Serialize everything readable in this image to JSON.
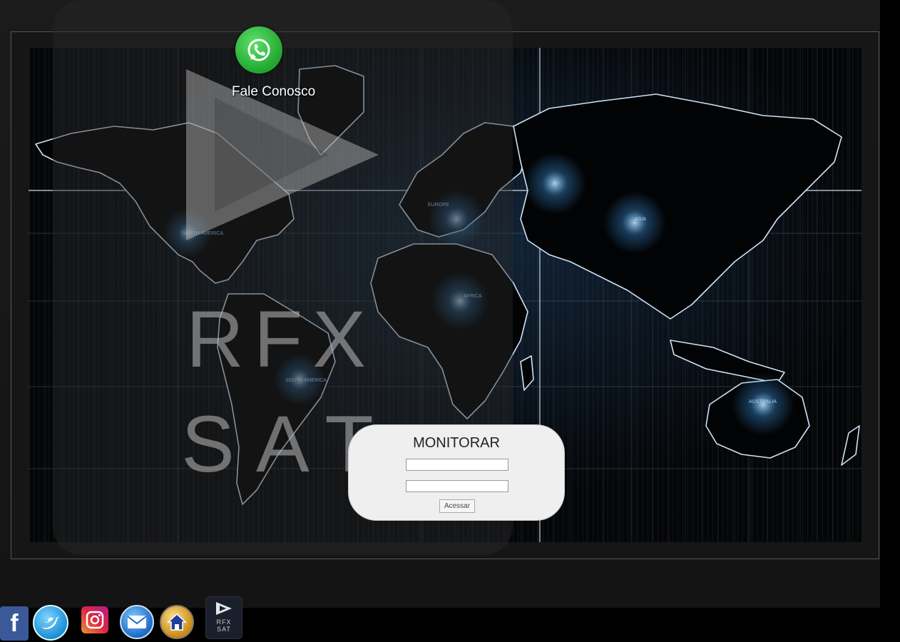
{
  "whatsapp": {
    "label": "Fale Conosco",
    "icon": "whatsapp-icon"
  },
  "watermark": {
    "line1": "RFX",
    "line2": "SAT"
  },
  "map": {
    "region_labels": [
      "NORTH AMERICA",
      "SOUTH AMERICA",
      "AFRICA",
      "EUROPE",
      "ASIA",
      "AUSTRALIA"
    ]
  },
  "login": {
    "title": "MONITORAR",
    "username_value": "",
    "password_value": "",
    "submit_label": "Acessar"
  },
  "social": {
    "items": [
      {
        "name": "facebook-icon",
        "glyph": "f"
      },
      {
        "name": "twitter-icon",
        "glyph": "t"
      },
      {
        "name": "instagram-icon",
        "glyph": ""
      },
      {
        "name": "email-icon",
        "glyph": ""
      },
      {
        "name": "home-icon",
        "glyph": ""
      }
    ],
    "rfx_small_line1": "RFX",
    "rfx_small_line2": "SAT"
  },
  "colors": {
    "background": "#000000",
    "whatsapp_green": "#25D366",
    "login_panel": "#efefef",
    "map_glow": "#3a8fd8"
  }
}
